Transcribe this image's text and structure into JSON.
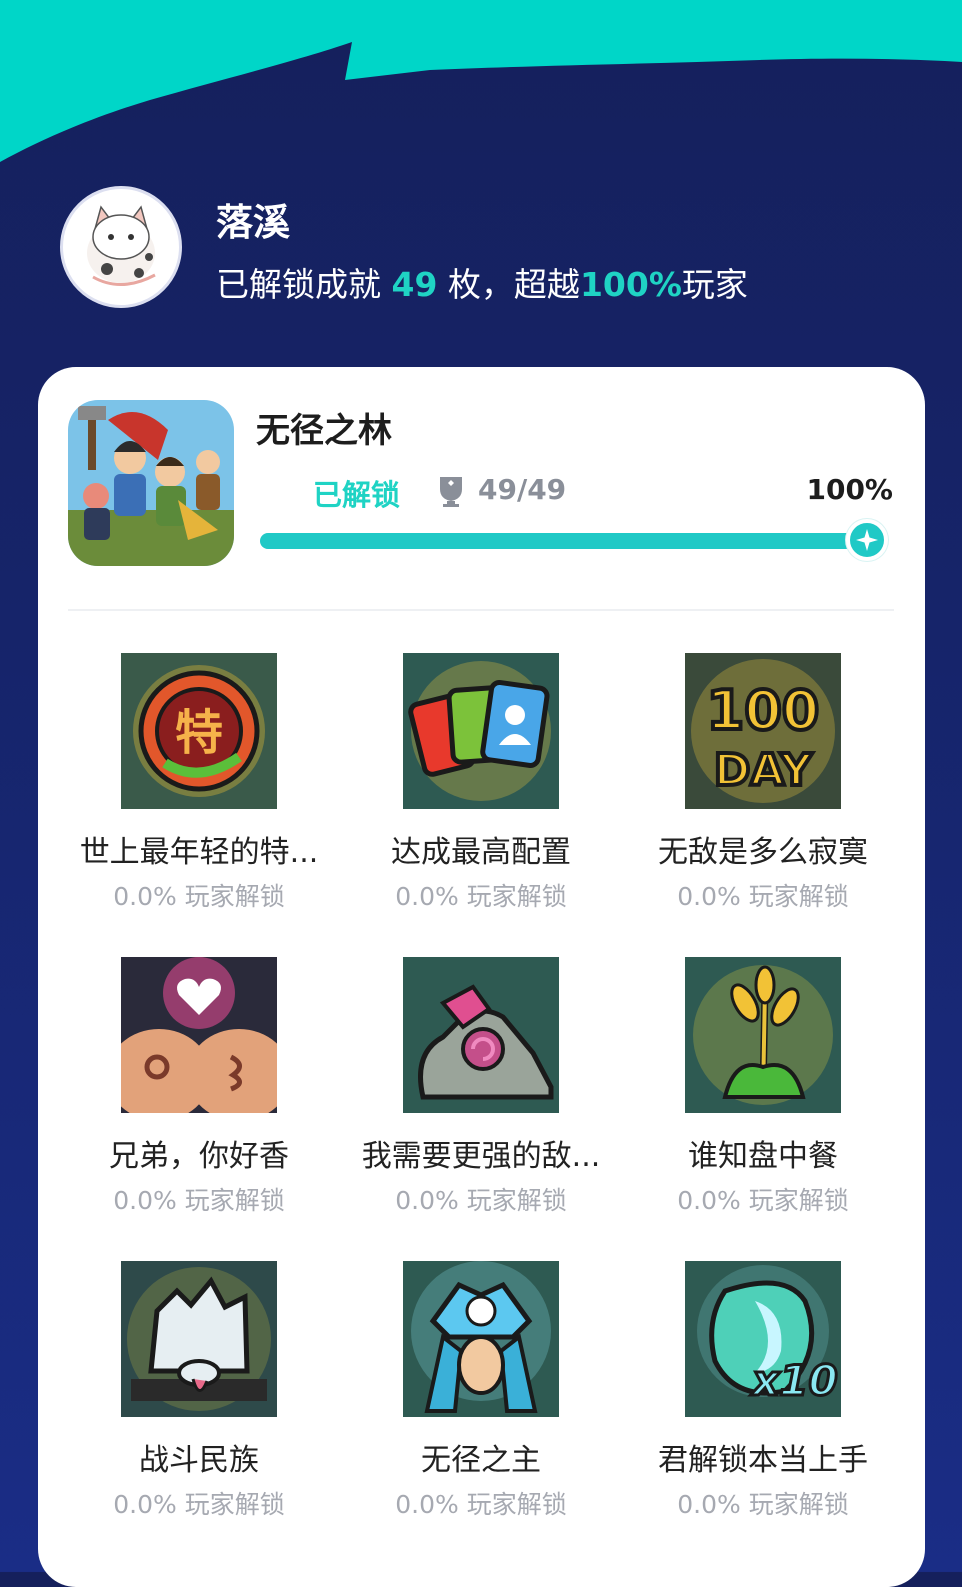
{
  "profile": {
    "username": "落溪",
    "summary_prefix": "已解锁成就 ",
    "count": "49",
    "summary_mid": " 枚，超越",
    "percent": "100%",
    "summary_suffix": "玩家",
    "avatar_icon": "avatar-cat-icon"
  },
  "game": {
    "title": "无径之林",
    "unlocked_label": "已解锁",
    "progress_count": "49/49",
    "progress_percent": "100%",
    "progress_fraction": 1.0,
    "trophy_icon": "trophy-icon",
    "icon": "game-cover-icon"
  },
  "achievements": [
    {
      "name": "世上最年轻的特...",
      "rate": "0.0% 玩家解锁",
      "icon": "special-badge-icon"
    },
    {
      "name": "达成最高配置",
      "rate": "0.0% 玩家解锁",
      "icon": "cards-icon"
    },
    {
      "name": "无敌是多么寂寞",
      "rate": "0.0% 玩家解锁",
      "icon": "100-day-icon"
    },
    {
      "name": "兄弟，你好香",
      "rate": "0.0% 玩家解锁",
      "icon": "heart-faces-icon"
    },
    {
      "name": "我需要更强的敌...",
      "rate": "0.0% 玩家解锁",
      "icon": "stone-monster-icon"
    },
    {
      "name": "谁知盘中餐",
      "rate": "0.0% 玩家解锁",
      "icon": "wheat-icon"
    },
    {
      "name": "战斗民族",
      "rate": "0.0% 玩家解锁",
      "icon": "white-wolf-icon"
    },
    {
      "name": "无径之主",
      "rate": "0.0% 玩家解锁",
      "icon": "forest-lord-icon"
    },
    {
      "name": "君解锁本当上手",
      "rate": "0.0% 玩家解锁",
      "icon": "x10-crest-icon"
    }
  ],
  "colors": {
    "accent": "#1fd3c4",
    "header_bg": "#15205c",
    "top_band": "#00d6c8"
  }
}
